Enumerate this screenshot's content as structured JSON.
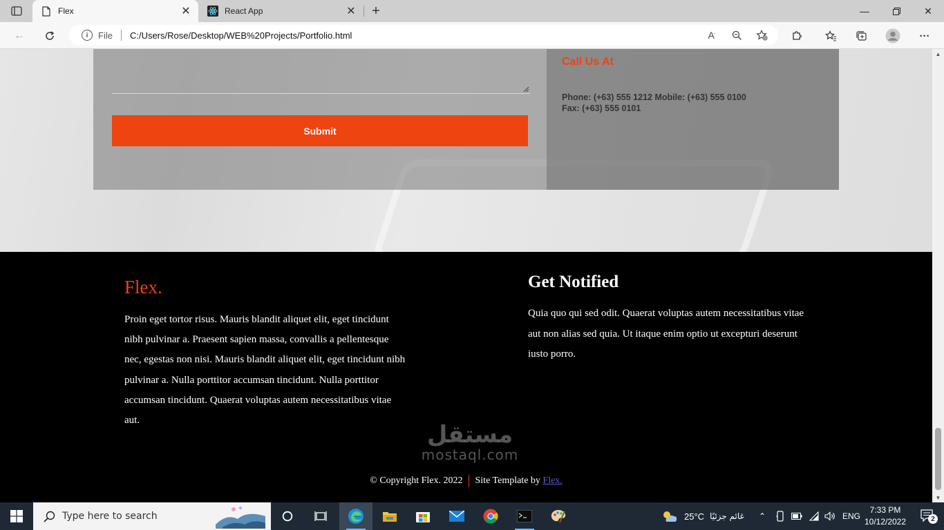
{
  "browser": {
    "tabs": [
      {
        "title": "Flex",
        "active": true
      },
      {
        "title": "React App",
        "active": false
      }
    ],
    "address": {
      "security_label": "File",
      "url": "C:/Users/Rose/Desktop/WEB%20Projects/Portfolio.html"
    }
  },
  "contact": {
    "submit_label": "Submit",
    "call_title": "Call Us At",
    "phone_line": "Phone: (+63) 555 1212 Mobile: (+63) 555 0100",
    "fax_line": "Fax: (+63) 555 0101"
  },
  "footer": {
    "brand": "Flex.",
    "about": "Proin eget tortor risus. Mauris blandit aliquet elit, eget tincidunt nibh pulvinar a. Praesent sapien massa, convallis a pellentesque nec, egestas non nisi. Mauris blandit aliquet elit, eget tincidunt nibh pulvinar a. Nulla porttitor accumsan tincidunt. Nulla porttitor accumsan tincidunt. Quaerat voluptas autem necessitatibus vitae aut.",
    "notified_title": "Get Notified",
    "notified_text": "Quia quo qui sed odit. Quaerat voluptas autem necessitatibus vitae aut non alias sed quia. Ut itaque enim optio ut excepturi deserunt iusto porro.",
    "copyright": "© Copyright Flex. 2022",
    "template_by": "Site Template by",
    "template_link": "Flex."
  },
  "watermark": {
    "arabic": "مستقل",
    "latin": "mostaql.com"
  },
  "taskbar": {
    "search_placeholder": "Type here to search",
    "temperature": "25°C",
    "weather": "غائم جزئيًا",
    "language": "ENG",
    "time": "7:33 PM",
    "date": "10/12/2022",
    "notification_count": "2"
  },
  "colors": {
    "accent": "#ee4410",
    "footer_bg": "#000000",
    "link": "#5e5ec9",
    "taskbar": "#1e2935"
  }
}
